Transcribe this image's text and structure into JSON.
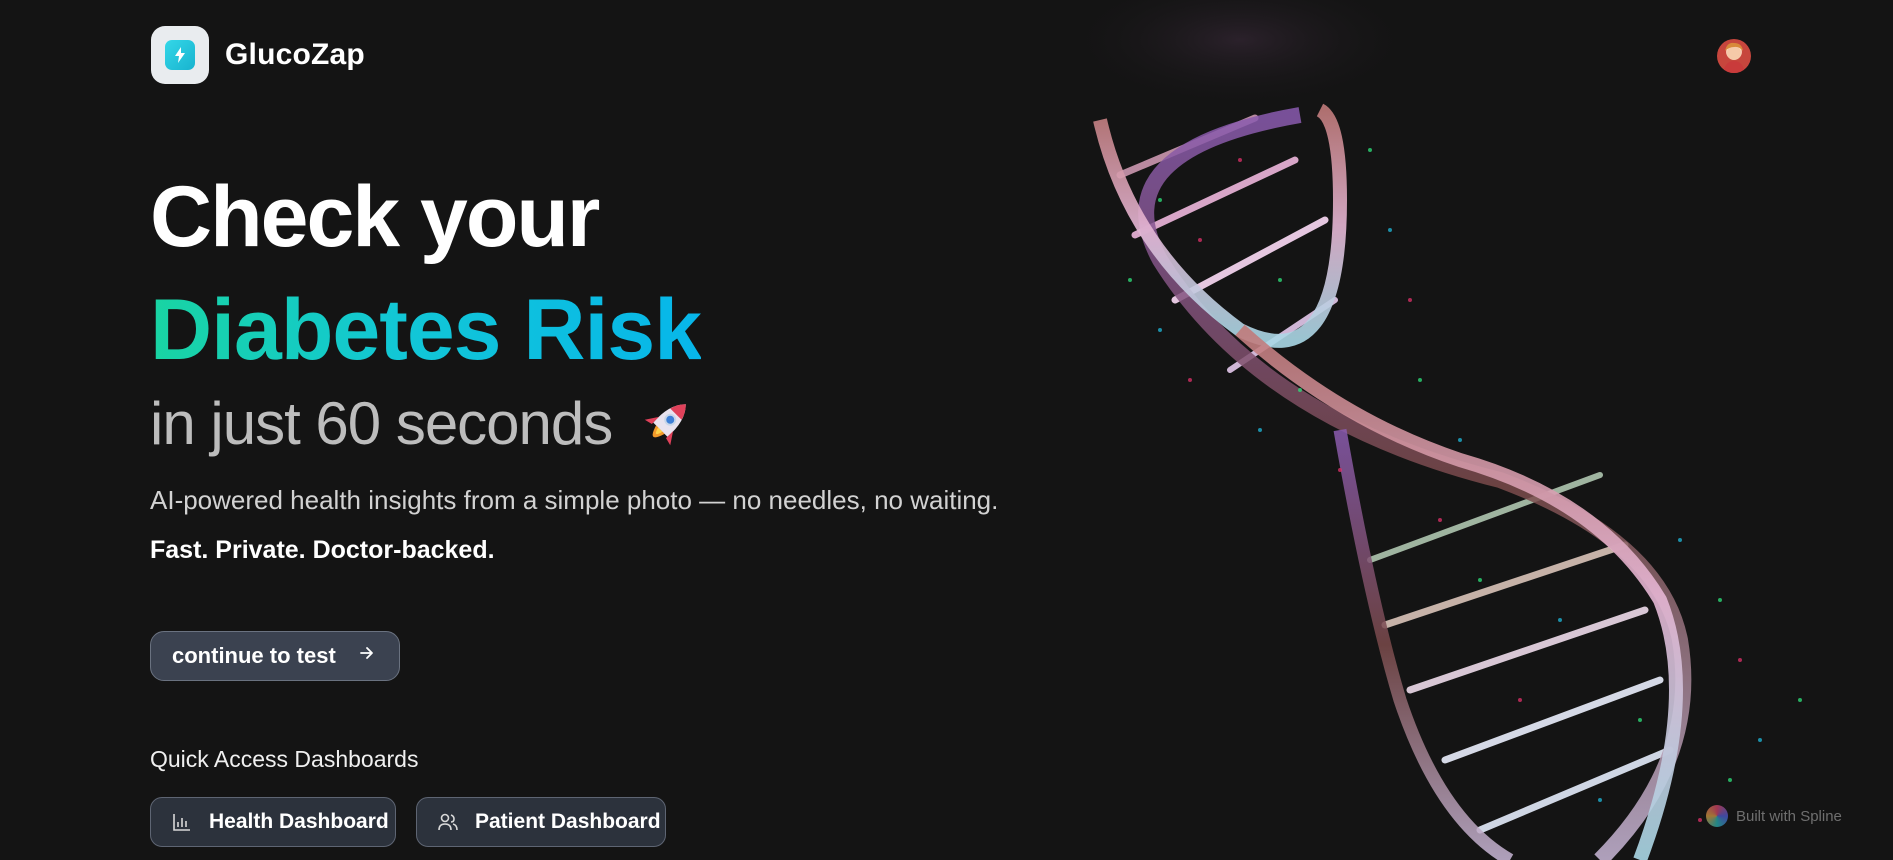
{
  "header": {
    "brand": "GlucoZap"
  },
  "hero": {
    "line1": "Check your",
    "line2": "Diabetes Risk",
    "line3": "in just 60 seconds",
    "subtitle": "AI-powered health insights from a simple photo — no needles, no waiting.",
    "tagline": "Fast. Private. Doctor-backed."
  },
  "cta": {
    "label": "continue to test",
    "icon": "arrow-right-icon"
  },
  "quick_access": {
    "title": "Quick Access Dashboards",
    "buttons": [
      {
        "label": "Health Dashboard",
        "icon": "bar-chart-icon"
      },
      {
        "label": "Patient Dashboard",
        "icon": "users-icon"
      }
    ]
  },
  "badge": {
    "label": "Built with Spline"
  },
  "colors": {
    "background": "#141414",
    "accent_green": "#19d4a2",
    "accent_cyan": "#07b6ea",
    "button_bg": "#3b4250"
  }
}
